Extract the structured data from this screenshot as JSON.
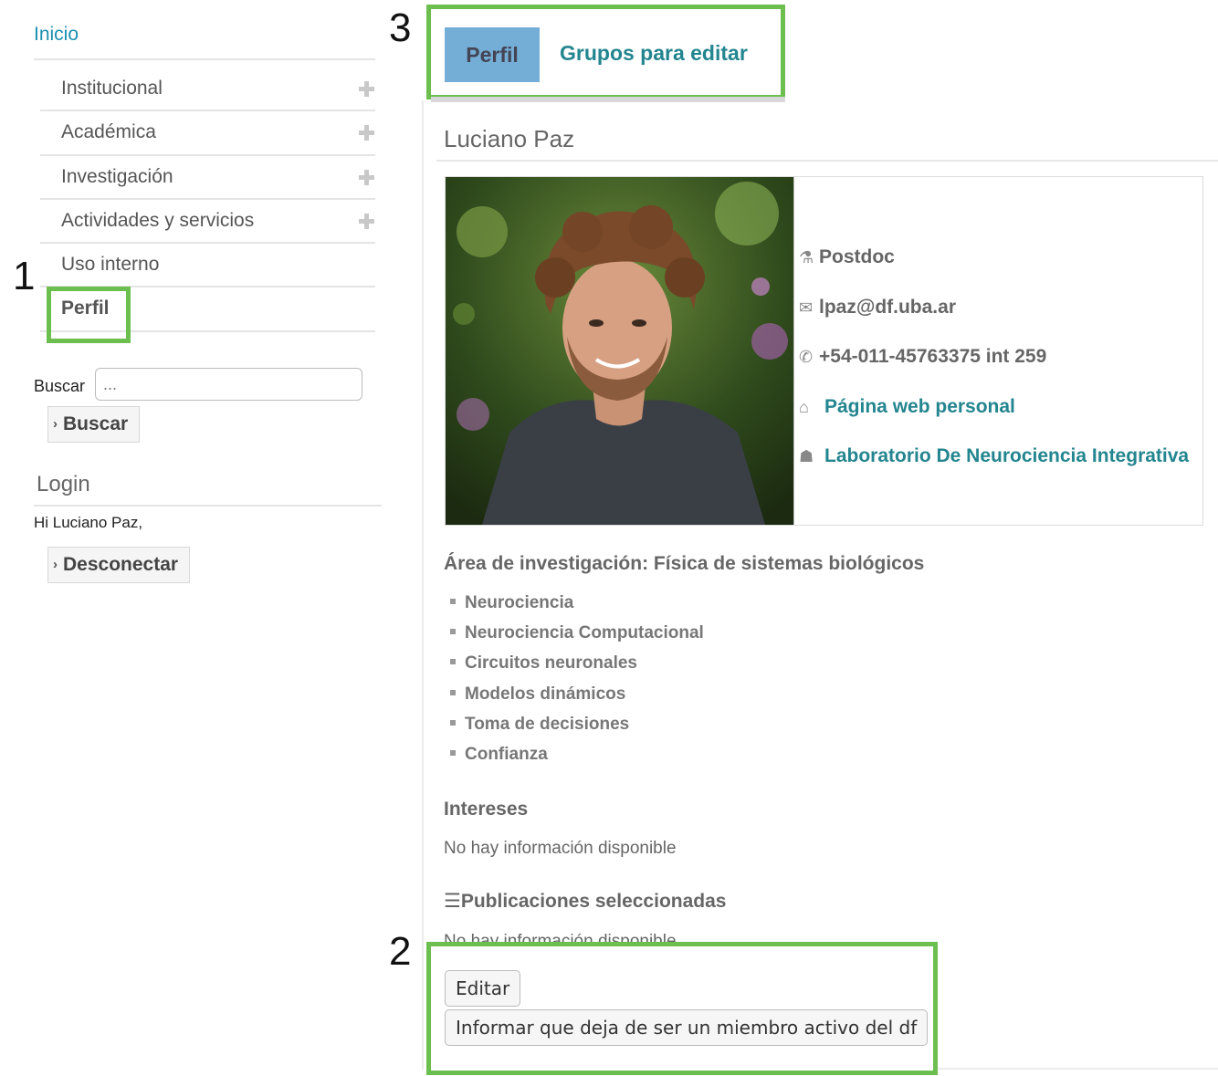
{
  "sidebar": {
    "home": "Inicio",
    "menu": [
      {
        "label": "Institucional",
        "expandable": true
      },
      {
        "label": "Académica",
        "expandable": true
      },
      {
        "label": "Investigación",
        "expandable": true
      },
      {
        "label": "Actividades y servicios",
        "expandable": true
      },
      {
        "label": "Uso interno",
        "expandable": false
      },
      {
        "label": "Perfil",
        "expandable": false,
        "active": true
      }
    ],
    "search": {
      "label": "Buscar",
      "placeholder": "...",
      "button": "Buscar"
    },
    "login": {
      "title": "Login",
      "greeting": "Hi Luciano Paz,",
      "logout": "Desconectar"
    }
  },
  "annotations": [
    "1",
    "2",
    "3"
  ],
  "tabs": [
    {
      "label": "Perfil",
      "active": true
    },
    {
      "label": "Grupos para editar",
      "active": false
    }
  ],
  "profile": {
    "name": "Luciano Paz",
    "position": "Postdoc",
    "email": "lpaz@df.uba.ar",
    "phone": "+54-011-45763375 int 259",
    "homepage": "Página web personal",
    "lab": "Laboratorio De Neurociencia Integrativa",
    "research_area": "Área de investigación: Física de sistemas biológicos",
    "keywords": [
      "Neurociencia",
      "Neurociencia Computacional",
      "Circuitos neuronales",
      "Modelos dinámicos",
      "Toma de decisiones",
      "Confianza"
    ],
    "interests_title": "Intereses",
    "interests_value": "No hay información disponible",
    "publications_title": "Publicaciones seleccionadas",
    "publications_value": "No hay información disponible"
  },
  "actions": {
    "edit": "Editar",
    "deactivate": "Informar que deja de ser un miembro activo del df"
  },
  "colors": {
    "accent_link": "#23858f",
    "active_tab": "#74aed6",
    "highlight": "#6cbf4f"
  }
}
